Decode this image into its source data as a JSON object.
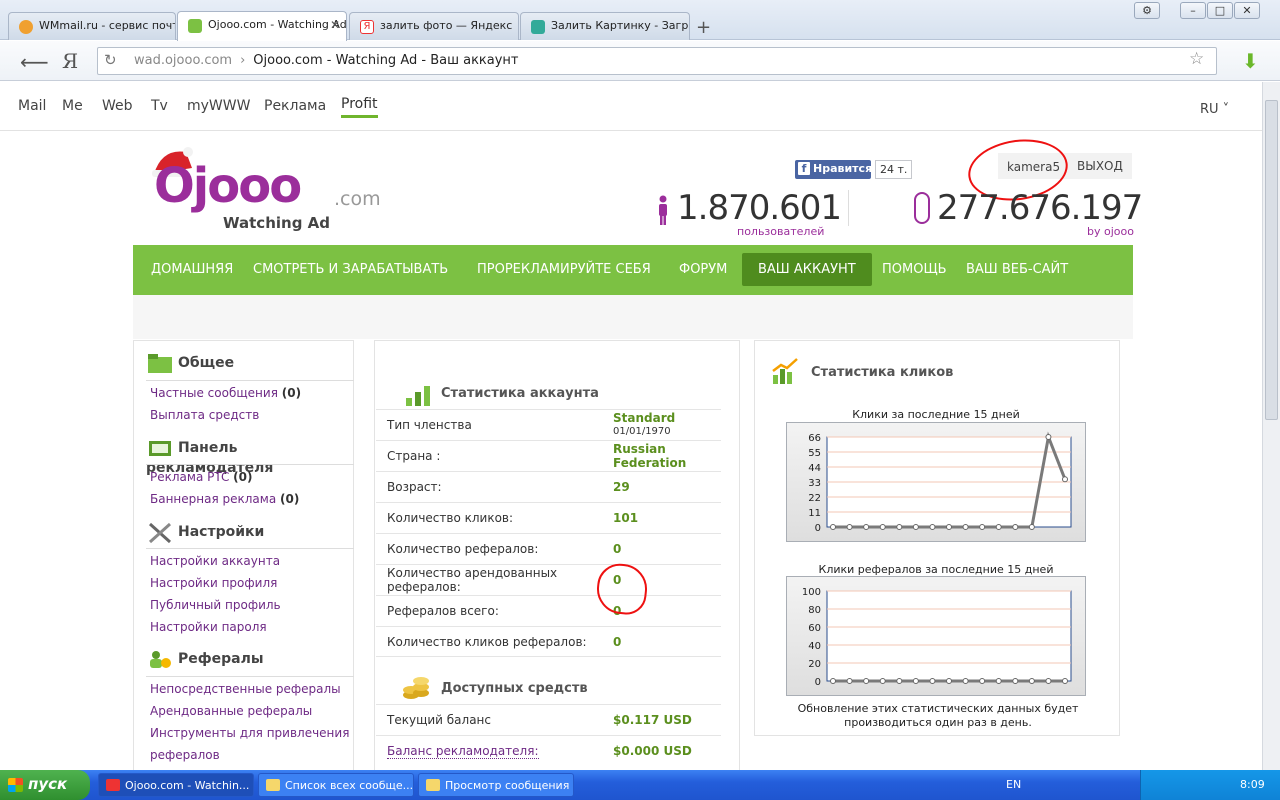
{
  "browser": {
    "tabs": [
      {
        "title": "WMmail.ru - сервис почт",
        "color": "#f0a030"
      },
      {
        "title": "Ojooo.com - Watching Ad",
        "color": "#7cc143"
      },
      {
        "title": "залить фото — Яндекс",
        "color": "#e33"
      },
      {
        "title": "Залить Картинку - Загр",
        "color": "#3a9"
      }
    ],
    "url_host": "wad.ojooo.com",
    "url_sep": "›",
    "url_title": "Ojooo.com - Watching Ad - Ваш аккаунт"
  },
  "topnav": {
    "items": [
      "Mail",
      "Me",
      "Web",
      "Tv",
      "myWWW",
      "Реклама",
      "Profit"
    ],
    "lang": "RU ˅"
  },
  "header": {
    "logo_main": "Ojooo",
    "logo_com": ".com",
    "logo_sub": "Watching Ad",
    "fb_like": "Нравится",
    "fb_count": "24 т.",
    "username": "kamera5",
    "logout": "ВЫХОД",
    "users_count": "1.870.601",
    "users_label": "пользователей",
    "clicks_count": "277.676.197",
    "clicks_label": "by ojooo"
  },
  "mainnav": [
    "ДОМАШНЯЯ",
    "СМОТРЕТЬ И ЗАРАБАТЫВАТЬ",
    "ПРОРЕКЛАМИРУЙТЕ СЕБЯ",
    "ФОРУМ",
    "ВАШ АККАУНТ",
    "ПОМОЩЬ",
    "ВАШ ВЕБ-САЙТ"
  ],
  "sidebar": {
    "general": {
      "title": "Общее",
      "links": [
        {
          "text": "Частные сообщения ",
          "count": "(0)"
        },
        {
          "text": "Выплата средств",
          "count": ""
        }
      ]
    },
    "advertiser": {
      "title": "Панель рекламодателя",
      "links": [
        {
          "text": "Реклама PTC ",
          "count": "(0)"
        },
        {
          "text": "Баннерная реклама ",
          "count": "(0)"
        }
      ]
    },
    "settings": {
      "title": "Настройки",
      "links": [
        "Настройки аккаунта",
        "Настройки профиля",
        "Публичный профиль",
        "Настройки пароля"
      ]
    },
    "referrals": {
      "title": "Рефералы",
      "links": [
        "Непосредственные рефералы",
        "Арендованные рефералы",
        "Инструменты для привлечения",
        "рефералов"
      ]
    }
  },
  "account": {
    "title": "Статистика аккаунта",
    "rows": [
      {
        "k": "Тип членства",
        "v": "Standard",
        "v2": "01/01/1970"
      },
      {
        "k": "Страна :",
        "v": "Russian",
        "v2": "Federation"
      },
      {
        "k": "Возраст:",
        "v": "29",
        "v2": ""
      },
      {
        "k": "Количество кликов:",
        "v": "101",
        "v2": ""
      },
      {
        "k": "Количество рефералов:",
        "v": "0",
        "v2": ""
      },
      {
        "k": "Количество арендованных",
        "k2": "рефералов:",
        "v": "0",
        "v2": ""
      },
      {
        "k": "Рефералов всего:",
        "v": "0",
        "v2": ""
      },
      {
        "k": "Количество кликов рефералов:",
        "v": "0",
        "v2": ""
      }
    ],
    "funds_title": "Доступных средств",
    "funds": [
      {
        "k": "Текущий баланс",
        "v": "$0.117 USD"
      },
      {
        "k": "Баланс рекламодателя:",
        "v": "$0.000 USD"
      }
    ]
  },
  "clicks_stats": {
    "title": "Статистика кликов",
    "note": "Обновление этих статистических данных будет производиться один раз в день."
  },
  "chart_data": [
    {
      "type": "line",
      "title": "Клики за последние 15 дней",
      "x": [
        1,
        2,
        3,
        4,
        5,
        6,
        7,
        8,
        9,
        10,
        11,
        12,
        13,
        14,
        15
      ],
      "values": [
        0,
        0,
        0,
        0,
        0,
        0,
        0,
        0,
        0,
        0,
        0,
        0,
        0,
        66,
        35
      ],
      "yticks": [
        0,
        11,
        22,
        33,
        44,
        55,
        66
      ],
      "ylim": [
        0,
        66
      ]
    },
    {
      "type": "line",
      "title": "Клики рефералов за последние 15 дней",
      "x": [
        1,
        2,
        3,
        4,
        5,
        6,
        7,
        8,
        9,
        10,
        11,
        12,
        13,
        14,
        15
      ],
      "values": [
        0,
        0,
        0,
        0,
        0,
        0,
        0,
        0,
        0,
        0,
        0,
        0,
        0,
        0,
        0
      ],
      "yticks": [
        0,
        20,
        40,
        60,
        80,
        100
      ],
      "ylim": [
        0,
        100
      ]
    }
  ],
  "taskbar": {
    "start": "пуск",
    "buttons": [
      "Ojooo.com - Watchin...",
      "Список всех сообще...",
      "Просмотр сообщения"
    ],
    "lang": "EN",
    "clock": "8:09"
  }
}
